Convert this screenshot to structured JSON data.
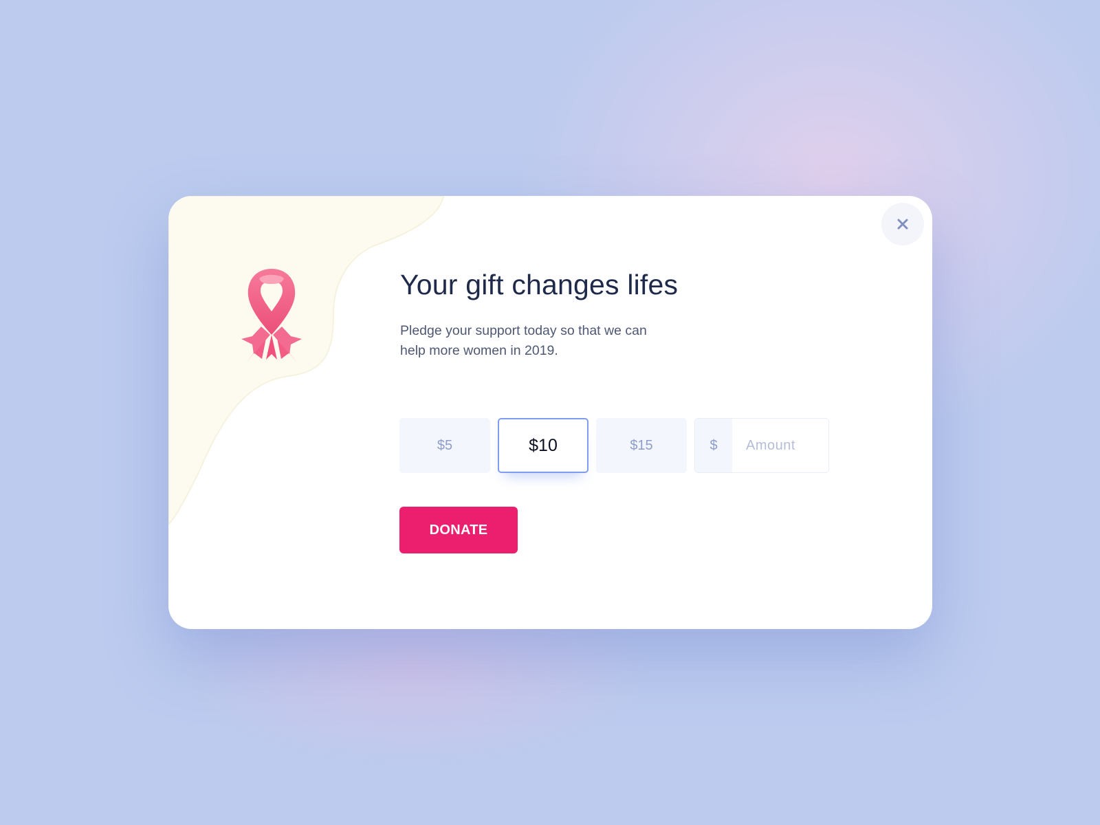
{
  "dialog": {
    "title": "Your gift changes lifes",
    "description": "Pledge your support today so that we can help more women in 2019.",
    "close_icon": "close-icon",
    "ribbon_icon": "awareness-ribbon-icon"
  },
  "amounts": {
    "options": [
      {
        "label": "$5",
        "selected": false
      },
      {
        "label": "$10",
        "selected": true
      },
      {
        "label": "$15",
        "selected": false
      }
    ],
    "custom": {
      "currency_symbol": "$",
      "placeholder": "Amount",
      "value": ""
    }
  },
  "actions": {
    "donate_label": "DONATE"
  },
  "colors": {
    "background": "#bccbee",
    "accent": "#ec1f6e",
    "selected_border": "#7e9cf0",
    "title_text": "#1f2a4a",
    "muted_text": "#8e9ccc",
    "blob": "#fdfbef",
    "ribbon": "#f46b8e"
  }
}
